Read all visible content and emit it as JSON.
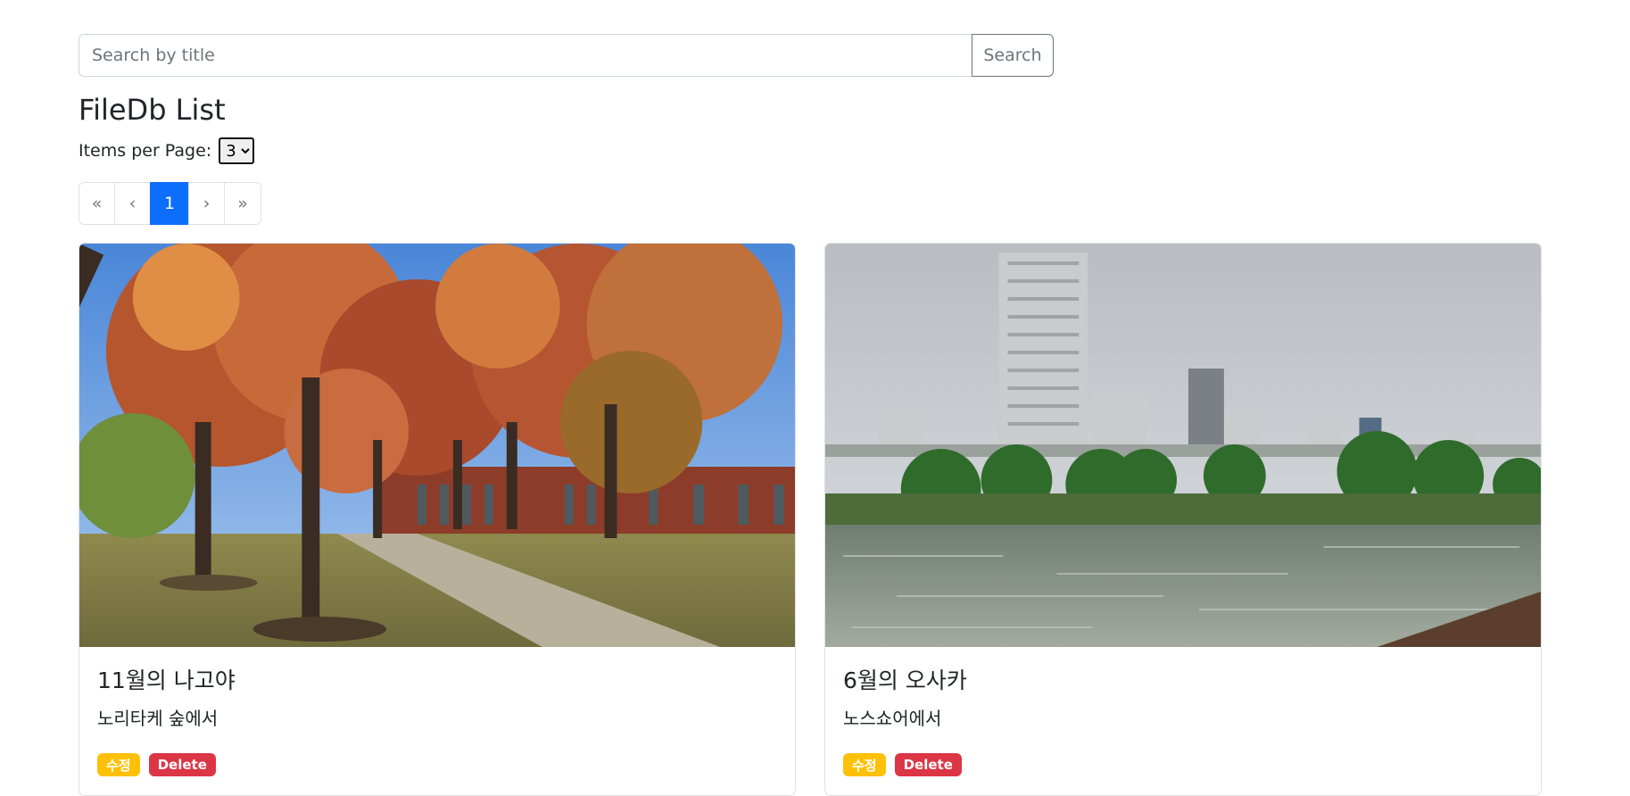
{
  "search": {
    "placeholder": "Search by title",
    "button_label": "Search"
  },
  "page_title": "FileDb List",
  "items_per_page": {
    "label": "Items per Page:",
    "selected": "3"
  },
  "pagination": {
    "first": "«",
    "prev": "‹",
    "current": "1",
    "next": "›",
    "last": "»"
  },
  "cards": [
    {
      "title": "11월의 나고야",
      "description": "노리타케 숲에서",
      "edit_label": "수정",
      "delete_label": "Delete",
      "image": "autumn-park-photo"
    },
    {
      "title": "6월의 오사카",
      "description": "노스쇼어에서",
      "edit_label": "수정",
      "delete_label": "Delete",
      "image": "river-city-photo"
    }
  ],
  "colors": {
    "primary": "#0d6efd",
    "warning": "#ffc107",
    "danger": "#dc3545",
    "border": "#dee2e6"
  }
}
